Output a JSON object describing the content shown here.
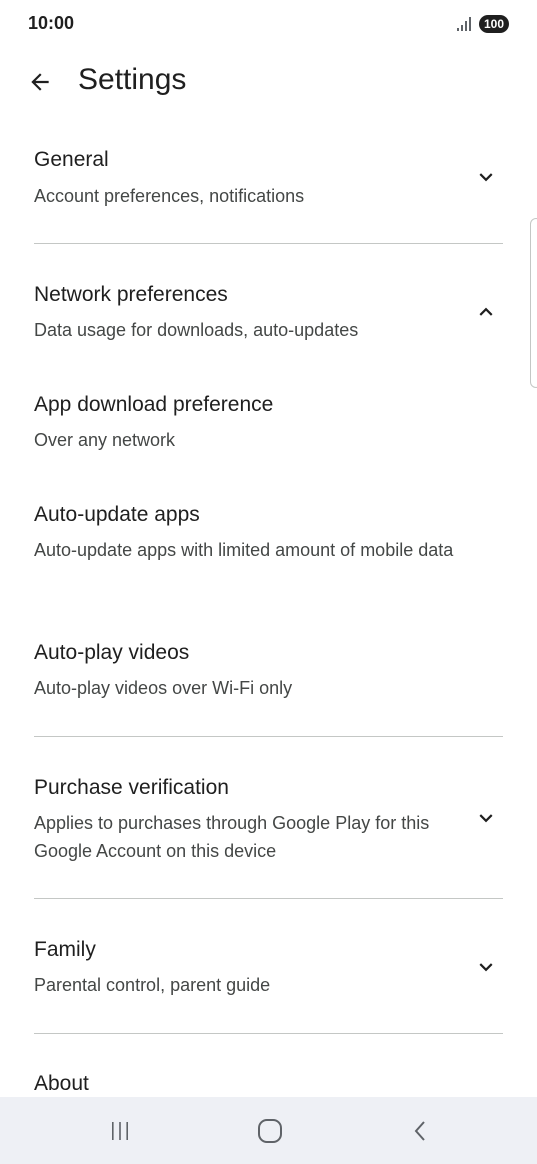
{
  "status_bar": {
    "time": "10:00",
    "battery": "100",
    "signal_icon": "signal-bars-icon"
  },
  "header": {
    "title": "Settings",
    "back_icon": "arrow-back-icon"
  },
  "sections": [
    {
      "title": "General",
      "subtitle": "Account preferences, notifications",
      "expanded": false
    },
    {
      "title": "Network preferences",
      "subtitle": "Data usage for downloads, auto-updates",
      "expanded": true,
      "items": [
        {
          "title": "App download preference",
          "subtitle": "Over any network"
        },
        {
          "title": "Auto-update apps",
          "subtitle": "Auto-update apps with limited amount of mobile data"
        },
        {
          "title": "Auto-play videos",
          "subtitle": "Auto-play videos over Wi-Fi only"
        }
      ]
    },
    {
      "title": "Purchase verification",
      "subtitle": "Applies to purchases through Google Play for this Google Account on this device",
      "expanded": false
    },
    {
      "title": "Family",
      "subtitle": "Parental control, parent guide",
      "expanded": false
    },
    {
      "title": "About",
      "subtitle": "",
      "expanded": false
    }
  ],
  "nav_bar": {
    "recents_icon": "recents-icon",
    "home_icon": "home-icon",
    "back_icon": "nav-back-icon"
  },
  "colors": {
    "text_primary": "#1f1f1f",
    "text_secondary": "#444746",
    "divider": "#c4c7c5",
    "nav_background": "#eef0f5"
  }
}
